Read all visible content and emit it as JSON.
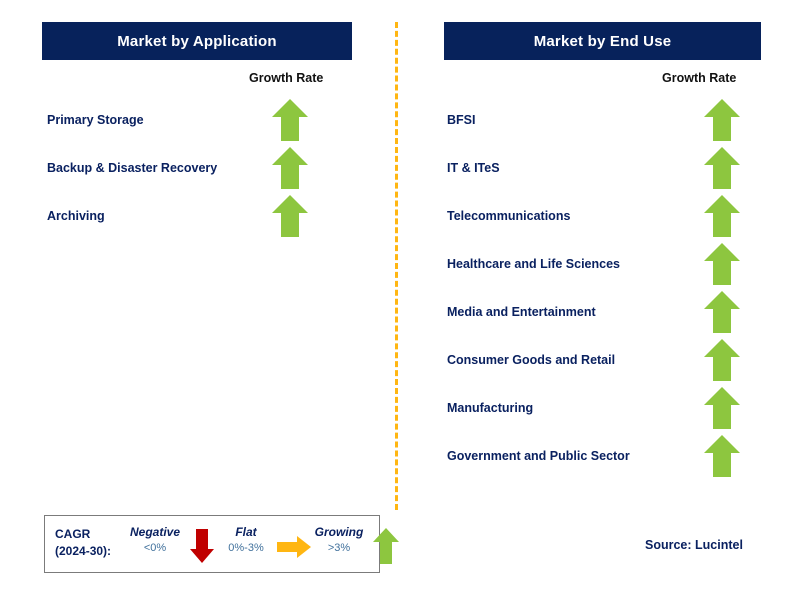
{
  "divider": {
    "color": "#FFB612",
    "style": "dashed"
  },
  "panels": [
    {
      "id": "application",
      "title": "Market by Application",
      "header_bg": "#07225B",
      "header_color": "#FFFFFF",
      "column_header": "Growth Rate",
      "rows": [
        {
          "label": "Primary Storage",
          "growth": "Growing",
          "icon": "arrow-up-icon",
          "color": "#8DC63F"
        },
        {
          "label": "Backup & Disaster Recovery",
          "growth": "Growing",
          "icon": "arrow-up-icon",
          "color": "#8DC63F"
        },
        {
          "label": "Archiving",
          "growth": "Growing",
          "icon": "arrow-up-icon",
          "color": "#8DC63F"
        }
      ]
    },
    {
      "id": "enduse",
      "title": "Market by End Use",
      "header_bg": "#07225B",
      "header_color": "#FFFFFF",
      "column_header": "Growth Rate",
      "rows": [
        {
          "label": "BFSI",
          "growth": "Growing",
          "icon": "arrow-up-icon",
          "color": "#8DC63F"
        },
        {
          "label": "IT & ITeS",
          "growth": "Growing",
          "icon": "arrow-up-icon",
          "color": "#8DC63F"
        },
        {
          "label": "Telecommunications",
          "growth": "Growing",
          "icon": "arrow-up-icon",
          "color": "#8DC63F"
        },
        {
          "label": "Healthcare and Life Sciences",
          "growth": "Growing",
          "icon": "arrow-up-icon",
          "color": "#8DC63F"
        },
        {
          "label": "Media and Entertainment",
          "growth": "Growing",
          "icon": "arrow-up-icon",
          "color": "#8DC63F"
        },
        {
          "label": "Consumer Goods and Retail",
          "growth": "Growing",
          "icon": "arrow-up-icon",
          "color": "#8DC63F"
        },
        {
          "label": "Manufacturing",
          "growth": "Growing",
          "icon": "arrow-up-icon",
          "color": "#8DC63F"
        },
        {
          "label": "Government and Public Sector",
          "growth": "Growing",
          "icon": "arrow-up-icon",
          "color": "#8DC63F"
        }
      ]
    }
  ],
  "legend": {
    "cagr_line1": "CAGR",
    "cagr_line2": "(2024-30):",
    "items": [
      {
        "title": "Negative",
        "range": "<0%",
        "icon": "arrow-down-icon",
        "color": "#C00000"
      },
      {
        "title": "Flat",
        "range": "0%-3%",
        "icon": "arrow-right-icon",
        "color": "#FFB612"
      },
      {
        "title": "Growing",
        "range": ">3%",
        "icon": "arrow-up-icon",
        "color": "#8DC63F"
      }
    ]
  },
  "source": "Source: Lucintel"
}
